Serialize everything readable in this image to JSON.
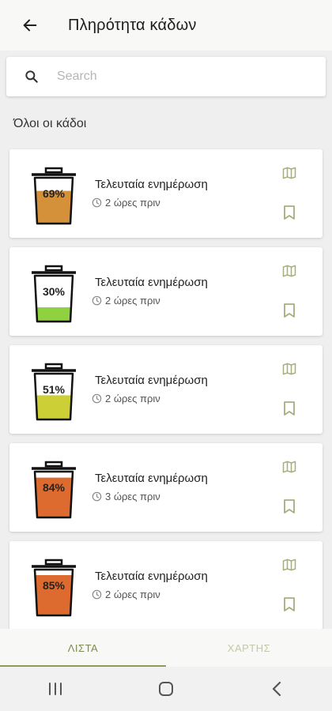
{
  "appbar": {
    "title": "Πληρότητα κάδων"
  },
  "search": {
    "placeholder": "Search"
  },
  "section": {
    "title": "Όλοι οι κάδοι"
  },
  "bins": [
    {
      "percent_label": "69%",
      "fill": 0.69,
      "color": "#d4913a",
      "label": "Τελευταία ενημέρωση",
      "time": "2 ώρες πριν"
    },
    {
      "percent_label": "30%",
      "fill": 0.3,
      "color": "#8fd13f",
      "label": "Τελευταία ενημέρωση",
      "time": "2 ώρες πριν"
    },
    {
      "percent_label": "51%",
      "fill": 0.51,
      "color": "#cccf35",
      "label": "Τελευταία ενημέρωση",
      "time": "2 ώρες πριν"
    },
    {
      "percent_label": "84%",
      "fill": 0.84,
      "color": "#dd6b2f",
      "label": "Τελευταία ενημέρωση",
      "time": "3 ώρες πριν"
    },
    {
      "percent_label": "85%",
      "fill": 0.85,
      "color": "#dd6b2f",
      "label": "Τελευταία ενημέρωση",
      "time": "2 ώρες πριν"
    }
  ],
  "tabs": {
    "list": "ΛΙΣΤΑ",
    "map": "ΧΑΡΤΗΣ"
  },
  "icons": {
    "back": "arrow-left-icon",
    "search": "search-icon",
    "clock": "clock-icon",
    "map": "map-icon",
    "bookmark": "bookmark-icon",
    "recents": "recents-icon",
    "home": "home-icon",
    "nav_back": "chevron-left-icon"
  },
  "colors": {
    "accent": "#8f9a5b",
    "icon_olive": "#a7ad7c"
  }
}
